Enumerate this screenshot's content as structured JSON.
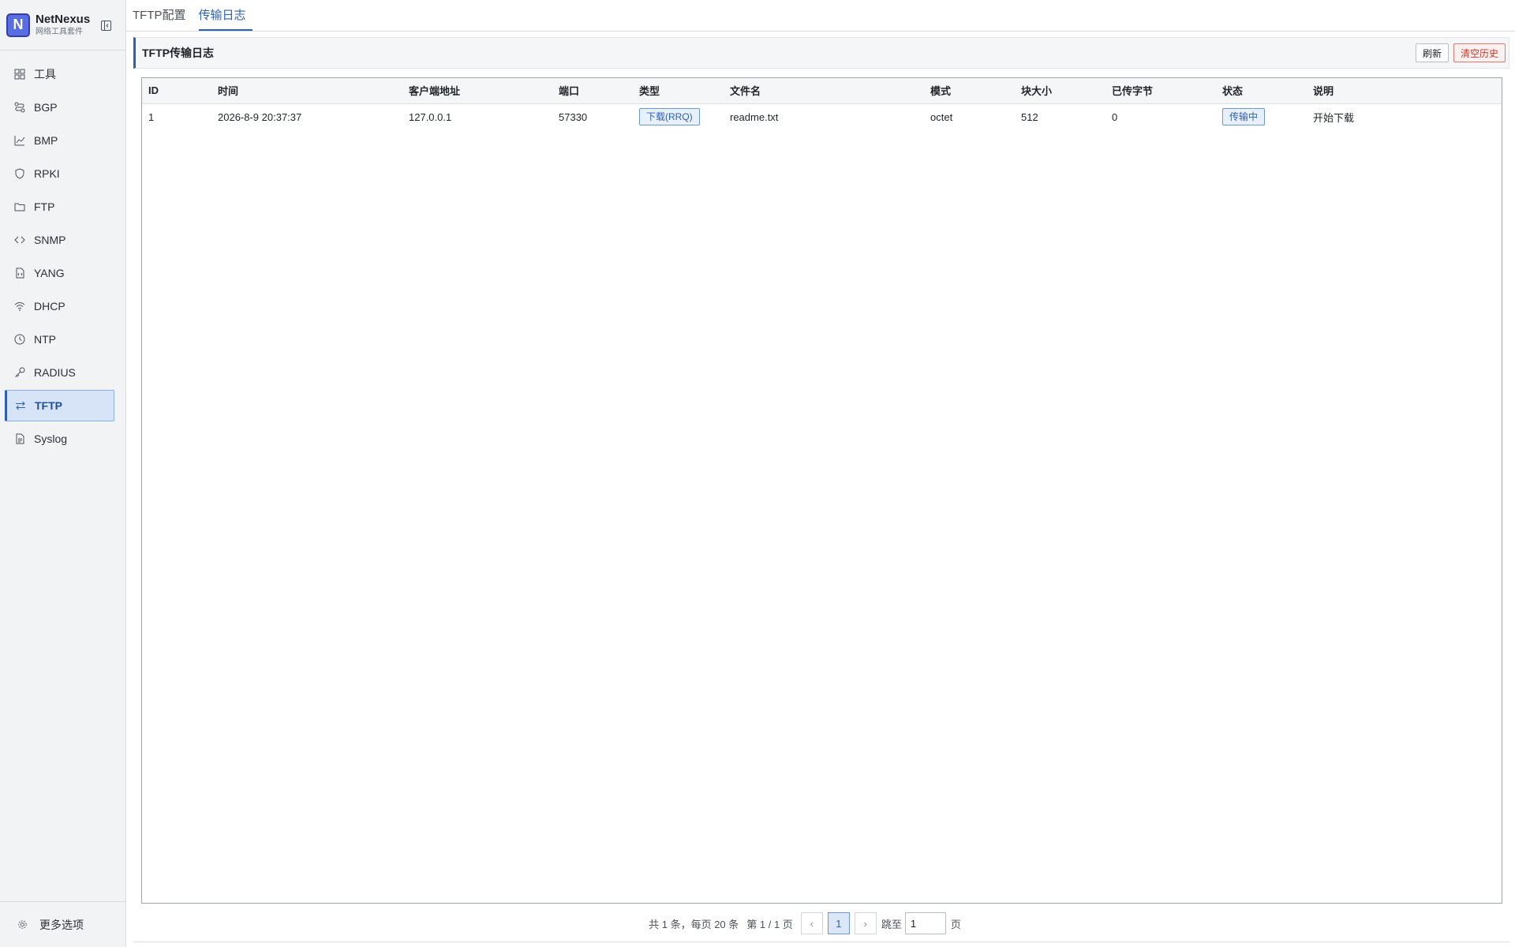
{
  "brand": {
    "name": "NetNexus",
    "subtitle": "网络工具套件",
    "logo_letter": "N"
  },
  "sidebar": {
    "items": [
      {
        "label": "工具",
        "icon": "grid-icon"
      },
      {
        "label": "BGP",
        "icon": "route-icon"
      },
      {
        "label": "BMP",
        "icon": "chart-icon"
      },
      {
        "label": "RPKI",
        "icon": "shield-icon"
      },
      {
        "label": "FTP",
        "icon": "folder-icon"
      },
      {
        "label": "SNMP",
        "icon": "code-icon"
      },
      {
        "label": "YANG",
        "icon": "file-code-icon"
      },
      {
        "label": "DHCP",
        "icon": "wifi-icon"
      },
      {
        "label": "NTP",
        "icon": "clock-icon"
      },
      {
        "label": "RADIUS",
        "icon": "key-icon"
      },
      {
        "label": "TFTP",
        "icon": "swap-icon",
        "active": true
      },
      {
        "label": "Syslog",
        "icon": "document-icon"
      }
    ],
    "footer_label": "更多选项"
  },
  "tabs": [
    {
      "label": "TFTP配置",
      "active": false
    },
    {
      "label": "传输日志",
      "active": true
    }
  ],
  "panel": {
    "title": "TFTP传输日志",
    "refresh_label": "刷新",
    "clear_label": "清空历史"
  },
  "table": {
    "columns": [
      "ID",
      "时间",
      "客户端地址",
      "端口",
      "类型",
      "文件名",
      "模式",
      "块大小",
      "已传字节",
      "状态",
      "说明"
    ],
    "rows": [
      {
        "id": "1",
        "time": "2026-8-9 20:37:37",
        "client": "127.0.0.1",
        "port": "57330",
        "type": "下载(RRQ)",
        "filename": "readme.txt",
        "mode": "octet",
        "block_size": "512",
        "bytes": "0",
        "status": "传输中",
        "note": "开始下载"
      }
    ]
  },
  "pagination": {
    "summary": "共 1 条，每页 20 条",
    "page_info": "第 1 / 1 页",
    "prev": "‹",
    "current": "1",
    "next": "›",
    "jump_label": "跳至",
    "jump_value": "1",
    "jump_suffix": "页"
  },
  "colors": {
    "accent": "#2d5fb4",
    "danger": "#c9372c",
    "sidebar_bg": "#f2f3f5"
  }
}
